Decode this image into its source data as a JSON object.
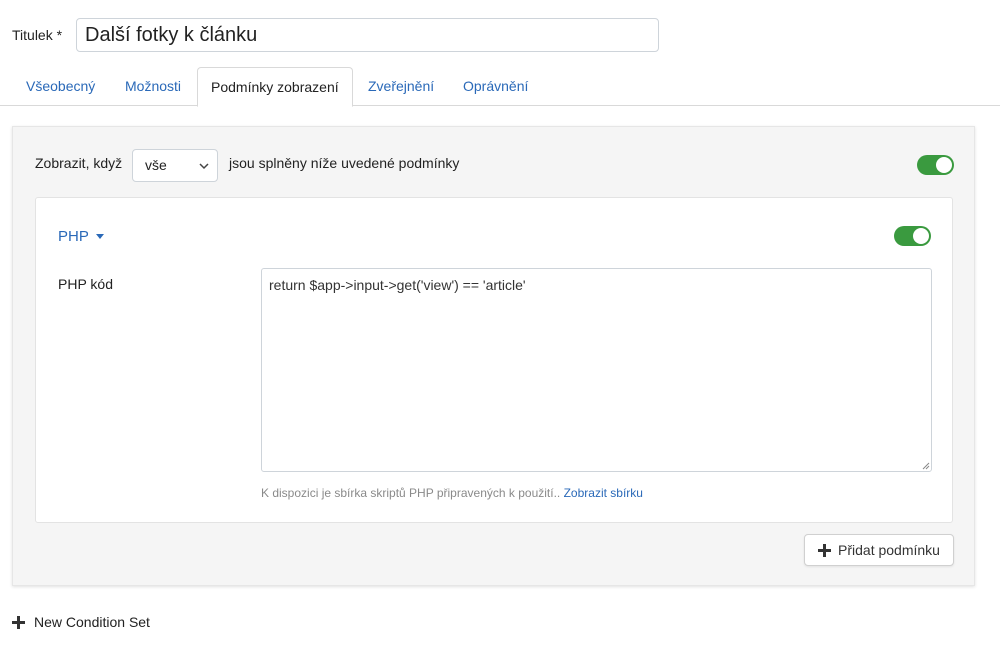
{
  "title_field": {
    "label": "Titulek *",
    "value": "Další fotky k článku"
  },
  "tabs": [
    {
      "label": "Všeobecný",
      "active": false
    },
    {
      "label": "Možnosti",
      "active": false
    },
    {
      "label": "Podmínky zobrazení",
      "active": true
    },
    {
      "label": "Zveřejnění",
      "active": false
    },
    {
      "label": "Oprávnění",
      "active": false
    }
  ],
  "condition_set": {
    "show_label": "Zobrazit, když",
    "match_select": {
      "selected": "vše"
    },
    "match_text": "jsou splněny níže uvedené podmínky",
    "enabled": true,
    "condition": {
      "type_label": "PHP",
      "enabled": true,
      "code_label": "PHP kód",
      "code_value": "return $app->input->get('view') == 'article'",
      "help_text": "K dispozici je sbírka skriptů PHP připravených k použití..",
      "help_link": "Zobrazit sbírku"
    },
    "add_condition_label": "Přidat podmínku"
  },
  "new_condition_set_label": "New Condition Set",
  "colors": {
    "accent": "#2a69b8",
    "toggle_on": "#3a9a3f"
  },
  "icons": {
    "dropdown": "chevron-down-icon",
    "type_menu": "caret-down-icon",
    "add": "plus-icon"
  }
}
